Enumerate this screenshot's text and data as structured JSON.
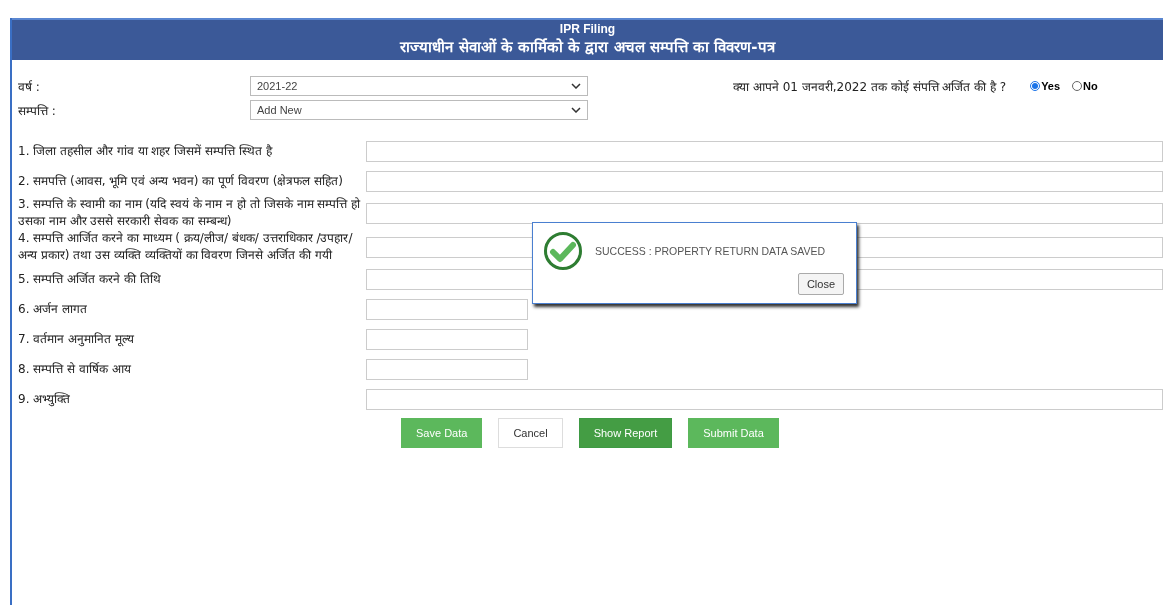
{
  "header": {
    "title": "IPR Filing",
    "subtitle": "राज्याधीन सेवाओं के कार्मिको के द्वारा अचल सम्पत्ति का विवरण-पत्र"
  },
  "selects": [
    {
      "label": "वर्ष :",
      "value": "2021-22"
    },
    {
      "label": "सम्पत्ति :",
      "value": "Add New"
    }
  ],
  "question": {
    "text": "क्या आपने 01 जनवरी,2022 तक कोई संपत्ति अर्जित की है ?",
    "options": [
      {
        "label": "Yes",
        "selected": true
      },
      {
        "label": "No",
        "selected": false
      }
    ]
  },
  "fields": [
    {
      "label": "1. जिला तहसील और गांव या शहर जिसमें सम्पत्ति स्थित है",
      "kind": "wide"
    },
    {
      "label": "2. समपत्ति (आवस, भूमि एवं अन्य भवन) का पूर्ण विवरण (क्षेत्रफल सहित)",
      "kind": "wide"
    },
    {
      "label": "3. सम्पत्ति के स्वामी का नाम (यदि स्वयं के नाम न हो तो जिसके नाम सम्पत्ति हो उसका नाम और उससे सरकारी सेवक का सम्बन्ध)",
      "kind": "wide"
    },
    {
      "label": "4. सम्पत्ति आर्जित करने का माध्यम ( क्रय/लीज/ बंधक/ उत्तराधिकार /उपहार/ अन्य प्रकार) तथा उस व्यक्ति व्यक्तियों का विवरण जिनसे अर्जित की गयी",
      "kind": "wide"
    },
    {
      "label": "5. सम्पत्ति अर्जित करने की तिथि",
      "kind": "wide"
    },
    {
      "label": "6. अर्जन लागत",
      "kind": "short"
    },
    {
      "label": "7. वर्तमान अनुमानित मूल्य",
      "kind": "short"
    },
    {
      "label": "8. सम्पत्ति से वार्षिक आय",
      "kind": "short"
    },
    {
      "label": "9. अभ्युक्ति",
      "kind": "wide"
    }
  ],
  "buttons": [
    {
      "label": "Save Data",
      "kind": "primary"
    },
    {
      "label": "Cancel",
      "kind": "default"
    },
    {
      "label": "Show Report",
      "kind": "active"
    },
    {
      "label": "Submit Data",
      "kind": "primary"
    }
  ],
  "dialog": {
    "message": "SUCCESS : PROPERTY RETURN DATA SAVED",
    "button": "Close"
  }
}
